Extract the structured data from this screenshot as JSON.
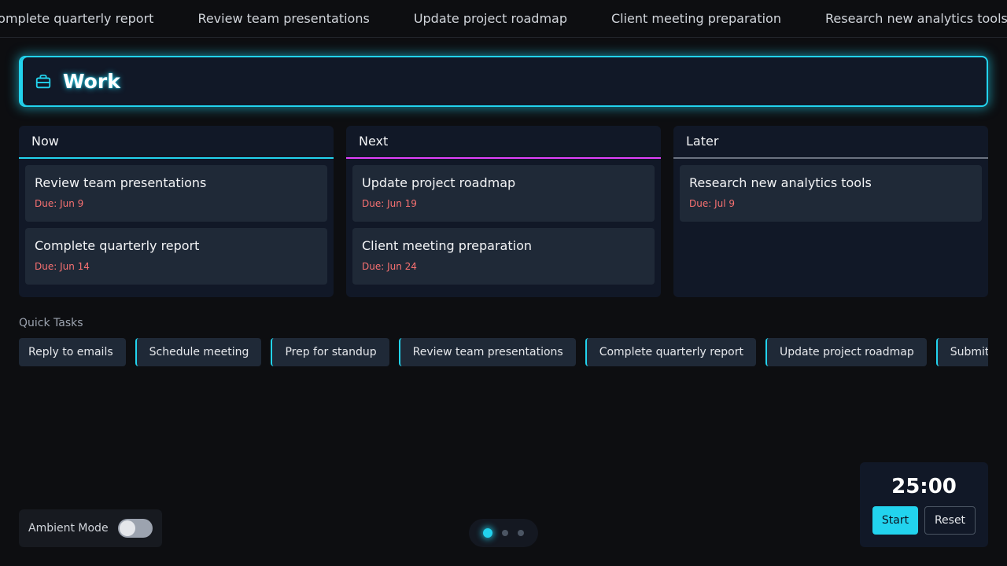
{
  "ticker": {
    "items": [
      "Complete quarterly report",
      "Review team presentations",
      "Update project roadmap",
      "Client meeting preparation",
      "Research new analytics tools"
    ]
  },
  "header": {
    "title": "Work",
    "icon": "briefcase-icon",
    "accent_color": "#22d3ee"
  },
  "columns": [
    {
      "title": "Now",
      "accent": "#22d3ee",
      "cards": [
        {
          "title": "Review team presentations",
          "due": "Due: Jun 9"
        },
        {
          "title": "Complete quarterly report",
          "due": "Due: Jun 14"
        }
      ]
    },
    {
      "title": "Next",
      "accent": "#e040fb",
      "cards": [
        {
          "title": "Update project roadmap",
          "due": "Due: Jun 19"
        },
        {
          "title": "Client meeting preparation",
          "due": "Due: Jun 24"
        }
      ]
    },
    {
      "title": "Later",
      "accent": "#6b7280",
      "cards": [
        {
          "title": "Research new analytics tools",
          "due": "Due: Jul 9"
        }
      ]
    }
  ],
  "quick_tasks": {
    "label": "Quick Tasks",
    "items": [
      "Reply to emails",
      "Schedule meeting",
      "Prep for standup",
      "Review team presentations",
      "Complete quarterly report",
      "Update project roadmap",
      "Submit"
    ]
  },
  "ambient": {
    "label": "Ambient Mode",
    "enabled": false
  },
  "pager": {
    "count": 3,
    "active": 1
  },
  "timer": {
    "display": "25:00",
    "start_label": "Start",
    "reset_label": "Reset"
  }
}
